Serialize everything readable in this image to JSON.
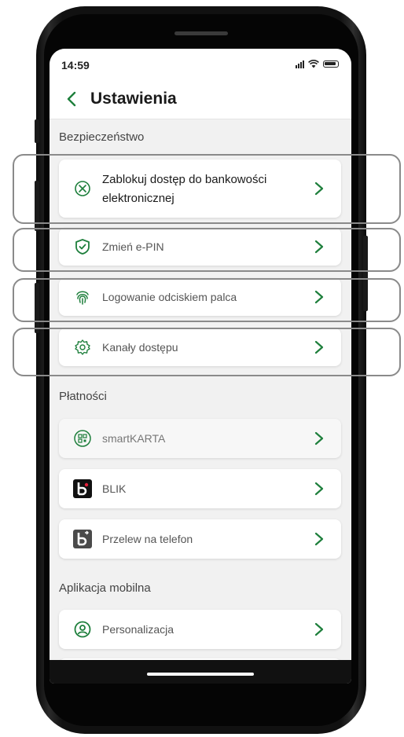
{
  "statusbar": {
    "time": "14:59"
  },
  "header": {
    "title": "Ustawienia"
  },
  "sections": {
    "security": "Bezpieczeństwo",
    "payments": "Płatności",
    "mobile_app": "Aplikacja mobilna"
  },
  "security_items": [
    {
      "label_line1": "Zablokuj dostęp do bankowości",
      "label_line2": "elektronicznej",
      "icon": "block-icon"
    },
    {
      "label": "Zmień e-PIN",
      "icon": "shield-check-icon"
    },
    {
      "label": "Logowanie odciskiem palca",
      "icon": "fingerprint-icon"
    },
    {
      "label": "Kanały dostępu",
      "icon": "gear-icon"
    }
  ],
  "payment_items": [
    {
      "label": "smartKARTA",
      "icon": "qr-code-icon"
    },
    {
      "label": "BLIK",
      "icon": "blik-icon"
    },
    {
      "label": "Przelew na telefon",
      "icon": "phone-transfer-icon"
    }
  ],
  "mobile_items": [
    {
      "label": "Personalizacja",
      "icon": "user-circle-icon"
    }
  ],
  "colors": {
    "accent": "#1e7f3c",
    "text": "#1a1a1a",
    "muted": "#555555",
    "background": "#f1f1f1"
  }
}
